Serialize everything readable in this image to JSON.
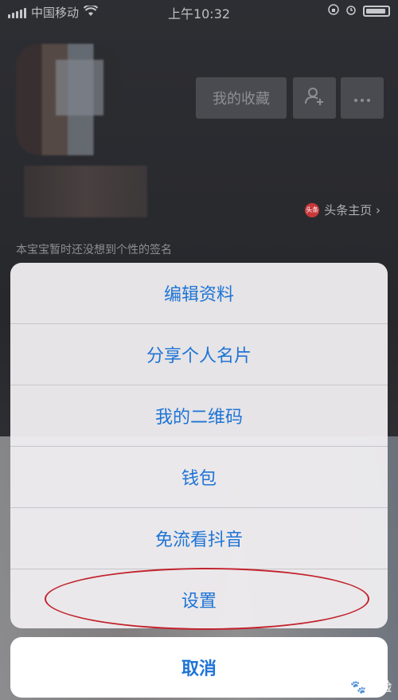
{
  "status_bar": {
    "carrier": "中国移动",
    "time": "上午10:32",
    "icons": [
      "signal-icon",
      "wifi-icon",
      "rotation-lock-icon",
      "alarm-icon",
      "battery-icon"
    ]
  },
  "profile": {
    "favorites_button": "我的收藏",
    "add_friend_icon": "add-user-icon",
    "more_icon": "more-dots-icon",
    "toutiao_logo_text": "头条",
    "toutiao_link": "头条主页 ›",
    "signature": "本宝宝暂时还没想到个性的签名"
  },
  "action_sheet": {
    "items": [
      {
        "label": "编辑资料"
      },
      {
        "label": "分享个人名片"
      },
      {
        "label": "我的二维码"
      },
      {
        "label": "钱包"
      },
      {
        "label": "免流看抖音"
      },
      {
        "label": "设置"
      }
    ],
    "cancel": "取消",
    "accent_color": "#1e74d6",
    "highlight_color": "#c2222e"
  },
  "watermark": "Bai🐾经验"
}
